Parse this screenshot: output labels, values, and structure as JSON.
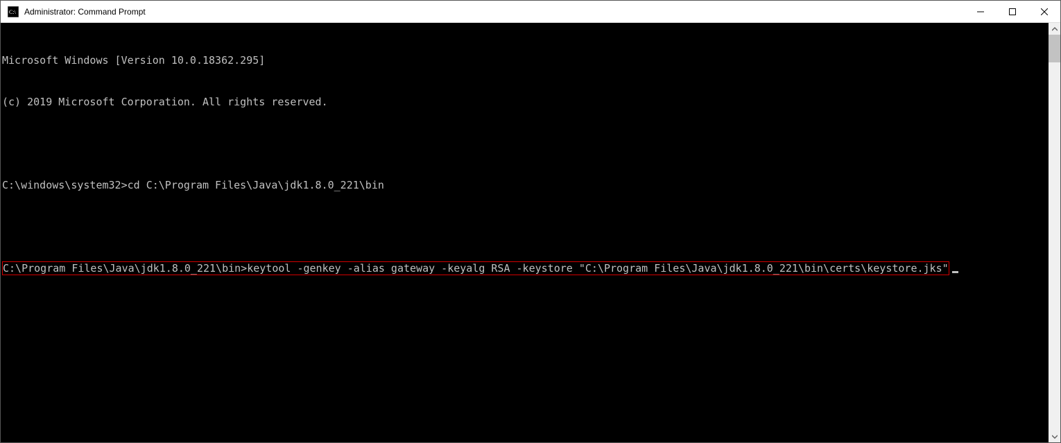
{
  "window": {
    "title": "Administrator: Command Prompt"
  },
  "terminal": {
    "line1": "Microsoft Windows [Version 10.0.18362.295]",
    "line2": "(c) 2019 Microsoft Corporation. All rights reserved.",
    "prompt1": "C:\\windows\\system32>",
    "cmd1": "cd C:\\Program Files\\Java\\jdk1.8.0_221\\bin",
    "prompt2": "C:\\Program Files\\Java\\jdk1.8.0_221\\bin>",
    "cmd2": "keytool -genkey -alias gateway -keyalg RSA -keystore \"C:\\Program Files\\Java\\jdk1.8.0_221\\bin\\certs\\keystore.jks\""
  }
}
